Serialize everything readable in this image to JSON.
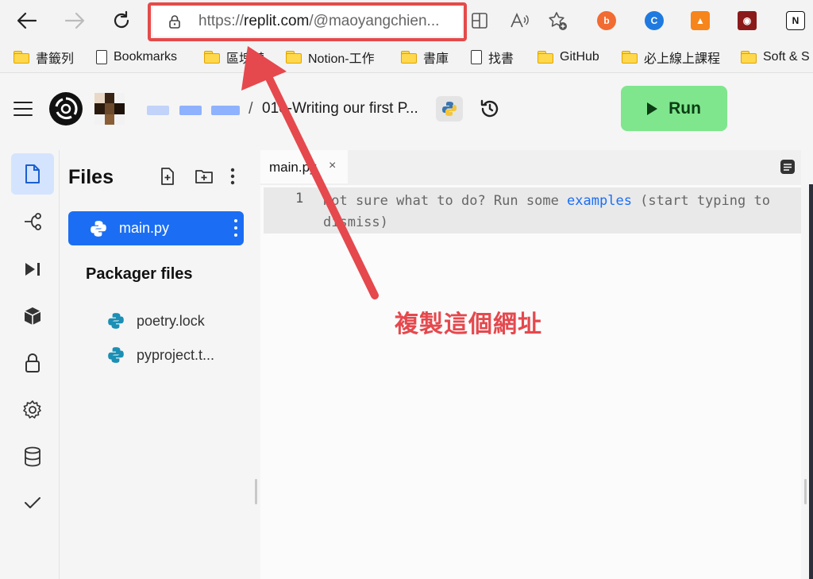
{
  "browser": {
    "url_prefix": "https://",
    "url_host": "replit.com",
    "url_path": "/@maoyangchien..."
  },
  "bookmarks": [
    {
      "label": "書籤列",
      "type": "folder"
    },
    {
      "label": "Bookmarks",
      "type": "page"
    },
    {
      "label": "區塊鏈",
      "type": "folder"
    },
    {
      "label": "Notion-工作",
      "type": "folder"
    },
    {
      "label": "書庫",
      "type": "folder"
    },
    {
      "label": "找書",
      "type": "page"
    },
    {
      "label": "GitHub",
      "type": "folder"
    },
    {
      "label": "必上線上課程",
      "type": "folder"
    },
    {
      "label": "Soft & S",
      "type": "folder"
    }
  ],
  "header": {
    "breadcrumb_sep": "/",
    "repl_title": "010-Writing our first P...",
    "run_label": "Run"
  },
  "files_panel": {
    "title": "Files",
    "files": [
      {
        "name": "main.py",
        "active": true
      }
    ],
    "packager_label": "Packager files",
    "packager_files": [
      {
        "name": "poetry.lock"
      },
      {
        "name": "pyproject.t..."
      }
    ]
  },
  "editor": {
    "tab_name": "main.py",
    "tab_close": "×",
    "line_number": "1",
    "hint_before": "Not sure what to do? Run some ",
    "hint_link": "examples",
    "hint_after": " (start typing to dismiss)"
  },
  "annotation": {
    "text": "複製這個網址",
    "color": "#e5484d"
  },
  "colors": {
    "accent": "#1b6ef3",
    "run_button": "#7fe68d",
    "highlight_border": "#e54a4a"
  }
}
